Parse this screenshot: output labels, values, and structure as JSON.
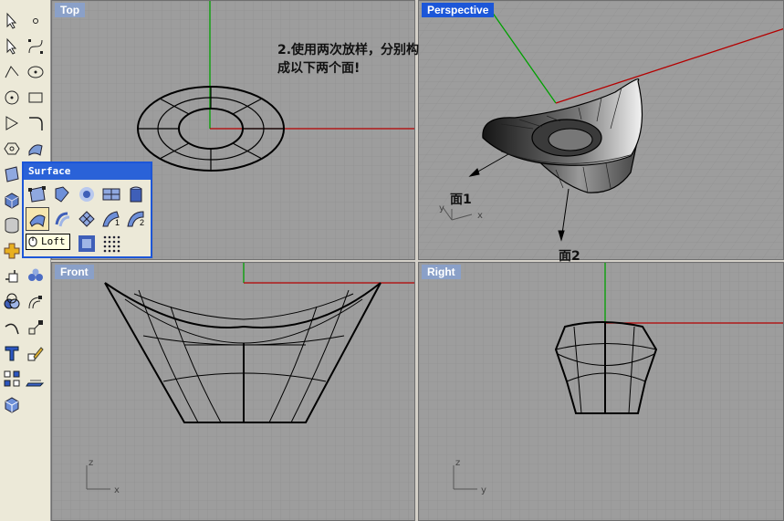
{
  "viewports": {
    "top": {
      "label": "Top"
    },
    "perspective": {
      "label": "Perspective"
    },
    "front": {
      "label": "Front"
    },
    "right": {
      "label": "Right"
    }
  },
  "annotation": {
    "line1": "2.使用两次放样，分别构",
    "line2": "成以下两个面!"
  },
  "surface_labels": {
    "face1": "面1",
    "face2": "面2"
  },
  "axes": {
    "x": "x",
    "y": "y",
    "z": "z"
  },
  "flyout": {
    "title": "Surface",
    "tooltip": "Loft",
    "badge1": "1",
    "badge2": "2"
  },
  "colors": {
    "active_viewport": "#1c56d8",
    "x_axis": "#b40000",
    "y_axis": "#00a000",
    "grid": "#8f8f8f"
  },
  "toolbar_icons": [
    "select-arrow-icon",
    "point-icon",
    "select-window-icon",
    "curve-icon",
    "polyline-icon",
    "circle-curve-icon",
    "circle-icon",
    "ellipse-icon",
    "polygon-icon",
    "rectangle-icon",
    "hexagon-icon",
    "fillet-icon",
    "surface-icon",
    "solid-box-icon",
    "mesh-icon",
    "transform-icon",
    "cylinder-icon",
    "boolean-icon",
    "dimension-icon",
    "text-icon",
    "grid-icon",
    "cplane-icon",
    "render-icon"
  ]
}
